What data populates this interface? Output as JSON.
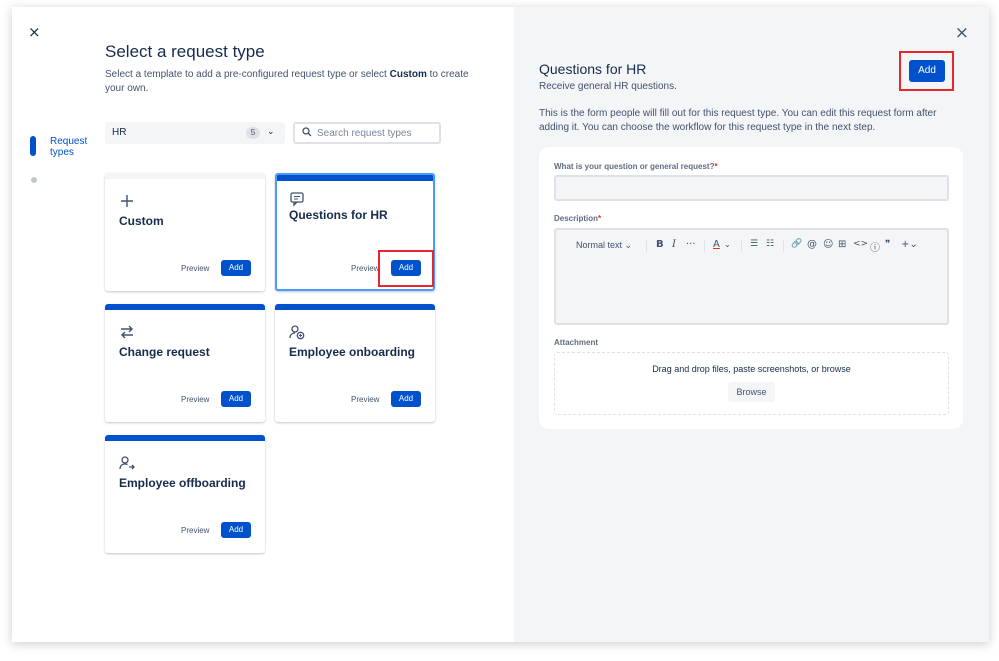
{
  "left": {
    "close_icon": "×",
    "title": "Select a request type",
    "subtitle_pre": "Select a template to add a pre-configured request type or select ",
    "subtitle_bold": "Custom",
    "subtitle_post": " to create your own.",
    "steps": [
      {
        "label_line1": "Request",
        "label_line2": "types"
      }
    ],
    "filter": {
      "value": "HR",
      "count": "5",
      "chevron": "⌄"
    },
    "search": {
      "placeholder": "Search request types"
    },
    "cards": [
      {
        "name": "Custom",
        "icon": "plus-icon",
        "preview": "Preview",
        "add": "Add"
      },
      {
        "name": "Questions for HR",
        "icon": "message-icon",
        "preview": "Preview",
        "add": "Add",
        "selected": true
      },
      {
        "name": "Change request",
        "icon": "swap-icon",
        "preview": "Preview",
        "add": "Add"
      },
      {
        "name": "Employee onboarding",
        "icon": "person-add-icon",
        "preview": "Preview",
        "add": "Add"
      },
      {
        "name": "Employee offboarding",
        "icon": "person-leave-icon",
        "preview": "Preview",
        "add": "Add"
      }
    ]
  },
  "right": {
    "close_icon": "×",
    "title": "Questions for HR",
    "subtitle": "Receive general HR questions.",
    "add": "Add",
    "description": "This is the form people will fill out for this request type. You can edit this request form after adding it. You can choose the workflow for this request type in the next step.",
    "form": {
      "q_label": "What is your question or general request?",
      "required_mark": "*",
      "desc_label": "Description",
      "toolbar": {
        "text_style": "Normal text ⌄",
        "bold": "B",
        "italic": "I",
        "more": "···",
        "color": "A",
        "color_chev": "⌄",
        "bullet": "☰",
        "numbered": "☷",
        "link": "🔗",
        "mention": "@",
        "emoji": "☺",
        "table": "⊞",
        "code": "<>",
        "info": "ⓘ",
        "quote": "❞",
        "insert": "+⌄"
      },
      "attach_label": "Attachment",
      "drop_text": "Drag and drop files, paste screenshots, or browse",
      "browse": "Browse"
    }
  },
  "colors": {
    "primary": "#0052cc",
    "highlight": "#e8262b",
    "panel": "#f4f5f7"
  }
}
